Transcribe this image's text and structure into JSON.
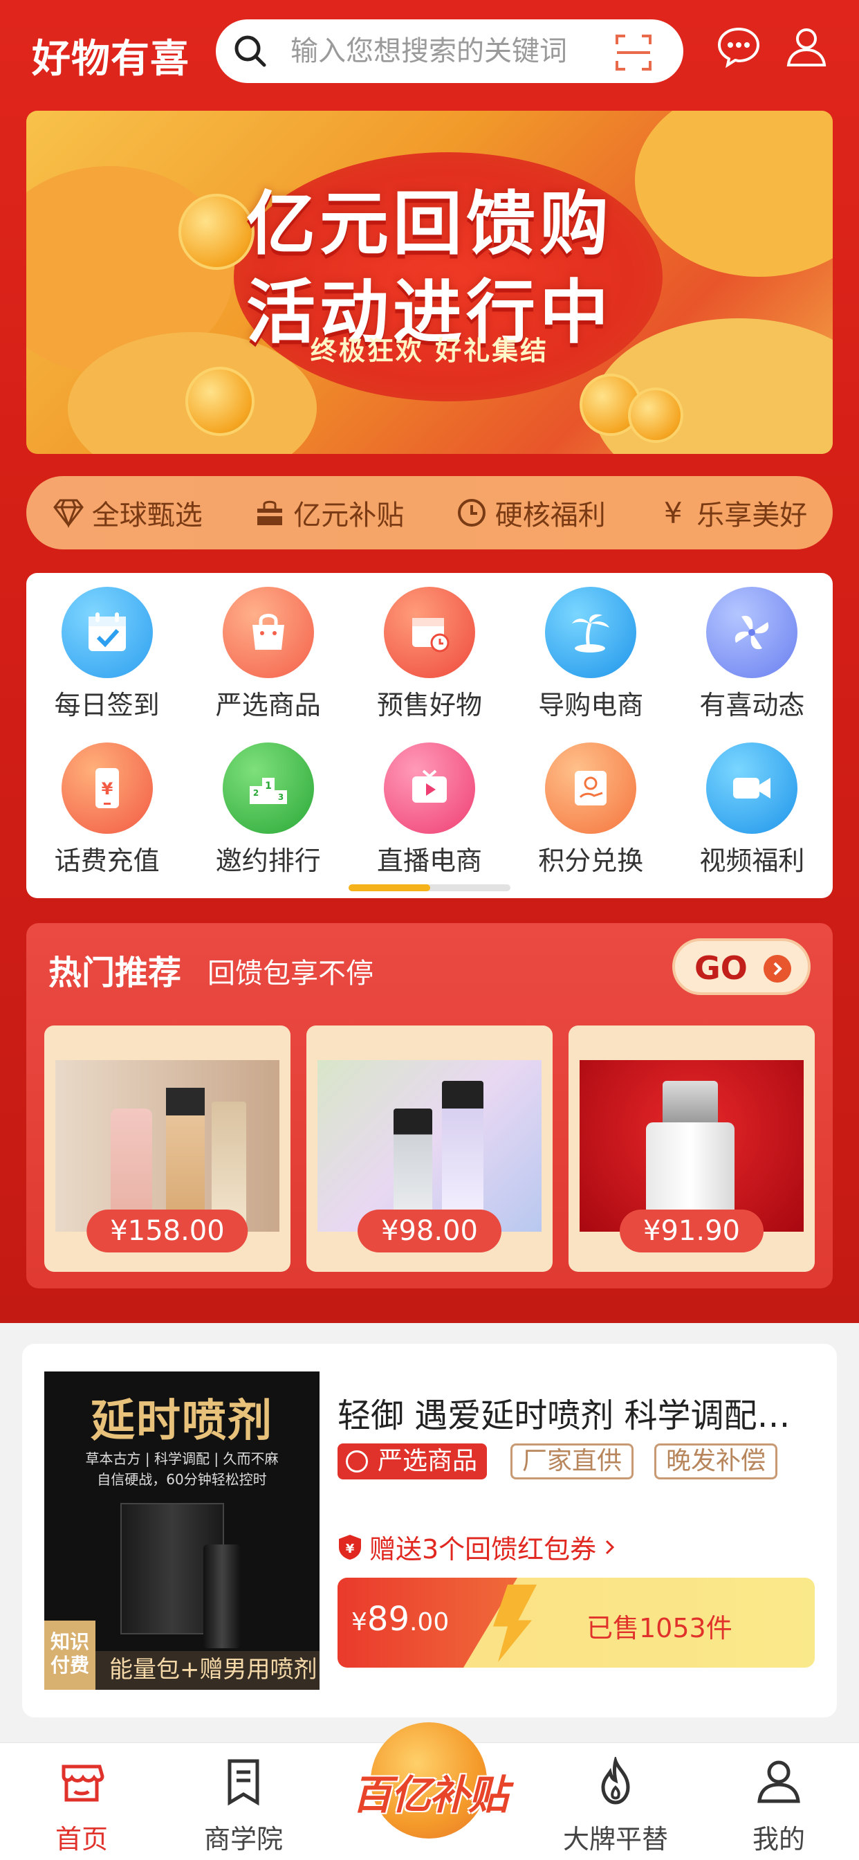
{
  "header": {
    "logo": "好物有喜",
    "search_placeholder": "输入您想搜索的关键词"
  },
  "banner": {
    "line1": "亿元回馈购",
    "line2": "活动进行中",
    "line3": "终极狂欢 好礼集结"
  },
  "strip": [
    {
      "icon": "diamond-icon",
      "label": "全球甄选"
    },
    {
      "icon": "shop-icon",
      "label": "亿元补贴"
    },
    {
      "icon": "clock-icon",
      "label": "硬核福利"
    },
    {
      "icon": "yen-icon",
      "label": "乐享美好"
    }
  ],
  "grid": [
    {
      "icon": "calendar-check-icon",
      "label": "每日签到",
      "color": "#3fb4f5"
    },
    {
      "icon": "shopping-bag-icon",
      "label": "严选商品",
      "color": "#f77a5a"
    },
    {
      "icon": "presale-calendar-icon",
      "label": "预售好物",
      "color": "#f2574a"
    },
    {
      "icon": "palm-island-icon",
      "label": "导购电商",
      "color": "#2aa8f0"
    },
    {
      "icon": "pinwheel-icon",
      "label": "有喜动态",
      "color": "#7b8ff0"
    },
    {
      "icon": "phone-yen-icon",
      "label": "话费充值",
      "color": "#f76a4a"
    },
    {
      "icon": "podium-icon",
      "label": "邀约排行",
      "color": "#3fb84a"
    },
    {
      "icon": "tv-play-icon",
      "label": "直播电商",
      "color": "#f2507a"
    },
    {
      "icon": "points-exchange-icon",
      "label": "积分兑换",
      "color": "#f5834a"
    },
    {
      "icon": "video-camera-icon",
      "label": "视频福利",
      "color": "#2aa8f0"
    }
  ],
  "hot": {
    "title": "热门推荐",
    "subtitle": "回馈包享不停",
    "go_label": "GO",
    "products": [
      {
        "price": "¥158.00"
      },
      {
        "price": "¥98.00"
      },
      {
        "price": "¥91.90"
      }
    ]
  },
  "product": {
    "image_heading": "延时喷剂",
    "image_line1": "草本古方 | 科学调配 | 久而不麻",
    "image_line2": "自信硬战，60分钟轻松控时",
    "image_badge": "知识付费",
    "image_bottom": "能量包+赠男用喷剂",
    "title": "轻御 遇爱延时喷剂 科学调配久而不麻",
    "tag_main": "严选商品",
    "tags": [
      "厂家直供",
      "晚发补偿"
    ],
    "gift": "赠送3个回馈红包券",
    "price_symbol": "¥",
    "price_int": "89",
    "price_dec": ".00",
    "sold": "已售1053件"
  },
  "tabbar": [
    {
      "icon": "store-icon",
      "label": "首页",
      "active": true
    },
    {
      "icon": "book-icon",
      "label": "商学院",
      "active": false
    },
    {
      "icon": "center-logo",
      "label": "百亿补贴",
      "active": false
    },
    {
      "icon": "flame-icon",
      "label": "大牌平替",
      "active": false
    },
    {
      "icon": "user-icon",
      "label": "我的",
      "active": false
    }
  ]
}
